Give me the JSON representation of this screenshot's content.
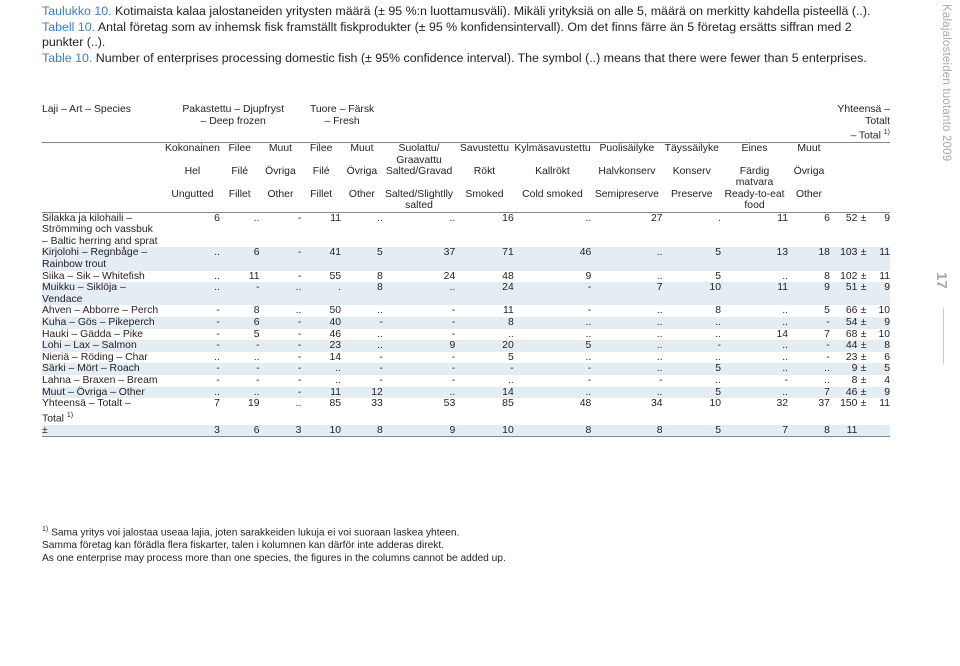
{
  "sidebar": {
    "title": "Kalajalosteiden tuotanto 2009",
    "page_number": "17"
  },
  "captions": [
    {
      "label": "Taulukko 10.",
      "text": "Kotimaista kalaa jalostaneiden yritysten määrä (± 95 %:n luottamusväli). Mikäli yrityksiä on alle 5, määrä on merkitty kahdella pisteellä (..)."
    },
    {
      "label": "Tabell 10.",
      "text": "Antal företag som av inhemsk fisk framställt fiskprodukter (± 95 % konfidensintervall). Om det finns färre än 5 företag ersätts siffran med 2 punkter (..)."
    },
    {
      "label": "Table 10.",
      "text": "Number of enterprises processing domestic fish  (± 95% confidence interval). The symbol (..) means that there were fewer than 5 enterprises."
    }
  ],
  "table": {
    "species_header": "Laji – Art – Species",
    "groups": [
      "Pakastettu – Djupfryst\n– Deep frozen",
      "Tuore – Färsk\n– Fresh"
    ],
    "total_header": "Yhteensä – Totalt\n– Total ",
    "total_header_sup": "1)",
    "columns": [
      {
        "fi": "Kokonainen",
        "sv": "Hel",
        "en": "Ungutted"
      },
      {
        "fi": "Filee",
        "sv": "Filé",
        "en": "Fillet"
      },
      {
        "fi": "Muut",
        "sv": "Övriga",
        "en": "Other"
      },
      {
        "fi": "Filee",
        "sv": "Filé",
        "en": "Fillet"
      },
      {
        "fi": "Muut",
        "sv": "Övriga",
        "en": "Other"
      },
      {
        "fi": "Suolattu/\nGraavattu",
        "sv": "Salted/Gravad",
        "en": "Salted/Slightlly\nsalted"
      },
      {
        "fi": "Savustettu",
        "sv": "Rökt",
        "en": "Smoked"
      },
      {
        "fi": "Kylmäsavustettu",
        "sv": "Kallrökt",
        "en": "Cold smoked"
      },
      {
        "fi": "Puolisäilyke",
        "sv": "Halvkonserv",
        "en": "Semipreserve"
      },
      {
        "fi": "Täyssäilyke",
        "sv": "Konserv",
        "en": "Preserve"
      },
      {
        "fi": "Eines",
        "sv": "Färdig matvara",
        "en": "Ready-to-eat\nfood"
      },
      {
        "fi": "Muut",
        "sv": "Övriga",
        "en": "Other"
      }
    ],
    "rows": [
      {
        "species": "Silakka ja kilohaili –\nStrömming och vassbuk\n– Baltic herring and sprat",
        "values": [
          "6",
          "..",
          "-",
          "11",
          "..",
          "..",
          "16",
          "..",
          "27",
          ".",
          "11",
          "6"
        ],
        "total": "52",
        "pm": "±",
        "ci": "9"
      },
      {
        "species": "Kirjolohi – Regnbåge –\nRainbow trout",
        "values": [
          "..",
          "6",
          "-",
          "41",
          "5",
          "37",
          "71",
          "46",
          "..",
          "5",
          "13",
          "18"
        ],
        "total": "103",
        "pm": "±",
        "ci": "11"
      },
      {
        "species": "Siika – Sik – Whitefish",
        "values": [
          "..",
          "11",
          "-",
          "55",
          "8",
          "24",
          "48",
          "9",
          "..",
          "5",
          "..",
          "8"
        ],
        "total": "102",
        "pm": "±",
        "ci": "11"
      },
      {
        "species": "Muikku – Siklöja –\nVendace",
        "values": [
          "..",
          "-",
          "..",
          ".",
          "8",
          "..",
          "24",
          "-",
          "7",
          "10",
          "11",
          "9"
        ],
        "total": "51",
        "pm": "±",
        "ci": "9"
      },
      {
        "species": "Ahven – Abborre – Perch",
        "values": [
          "-",
          "8",
          "..",
          "50",
          "..",
          "-",
          "11",
          "-",
          "..",
          "8",
          "..",
          "5"
        ],
        "total": "66",
        "pm": "±",
        "ci": "10"
      },
      {
        "species": "Kuha – Gös – Pikeperch",
        "values": [
          "-",
          "6",
          "-",
          "40",
          "-",
          "-",
          "8",
          "..",
          "..",
          "..",
          "..",
          "-"
        ],
        "total": "54",
        "pm": "±",
        "ci": "9"
      },
      {
        "species": "Hauki – Gädda – Pike",
        "values": [
          "-",
          "5",
          "-",
          "46",
          "..",
          "-",
          "..",
          "..",
          "..",
          "..",
          "14",
          "7"
        ],
        "total": "68",
        "pm": "±",
        "ci": "10"
      },
      {
        "species": "Lohi – Lax – Salmon",
        "values": [
          "-",
          "-",
          "-",
          "23",
          "..",
          "9",
          "20",
          "5",
          "..",
          "-",
          "..",
          "-"
        ],
        "total": "44",
        "pm": "±",
        "ci": "8"
      },
      {
        "species": "Nieriä – Röding – Char",
        "values": [
          "..",
          "..",
          "-",
          "14",
          "-",
          "-",
          "5",
          "..",
          "..",
          "..",
          "..",
          "-"
        ],
        "total": "23",
        "pm": "±",
        "ci": "6"
      },
      {
        "species": "Särki – Mört – Roach",
        "values": [
          "-",
          "-",
          "-",
          "..",
          "-",
          "-",
          "-",
          "-",
          "..",
          "5",
          "..",
          ".."
        ],
        "total": "9",
        "pm": "±",
        "ci": "5"
      },
      {
        "species": "Lahna – Braxen – Bream",
        "values": [
          "-",
          "-",
          "-",
          "..",
          "-",
          "-",
          "..",
          "-",
          "-",
          "..",
          "-",
          ".."
        ],
        "total": "8",
        "pm": "±",
        "ci": "4"
      },
      {
        "species": "Muut – Övriga – Other",
        "values": [
          "..",
          "..",
          "-",
          "11",
          "12",
          "..",
          "14",
          "..",
          "..",
          "5",
          "..",
          "7"
        ],
        "total": "46",
        "pm": "±",
        "ci": "9"
      }
    ],
    "total_row": {
      "species": "Yhteensä – Totalt –\nTotal ",
      "species_sup": "1)",
      "values": [
        "7",
        "19",
        "..",
        "85",
        "33",
        "53",
        "85",
        "48",
        "34",
        "10",
        "32",
        "37"
      ],
      "total": "150",
      "pm": "±",
      "ci": "11"
    },
    "ci_row": {
      "label": "±",
      "values": [
        "3",
        "6",
        "3",
        "10",
        "8",
        "9",
        "10",
        "8",
        "8",
        "5",
        "7",
        "8"
      ],
      "total": "11",
      "pm": "",
      "ci": ""
    }
  },
  "footnote": {
    "marker": "1)",
    "lines": [
      "Sama yritys voi jalostaa useaa lajia, joten sarakkeiden lukuja ei voi suoraan laskea yhteen.",
      "Samma företag kan förädla flera fiskarter, talen i kolumnen kan därför inte adderas direkt.",
      "As one enterprise may process more than one species, the figures in the columns cannot be added up."
    ]
  },
  "colors": {
    "caption_label": "#3f7fbf",
    "row_alt": "#e4ecf4",
    "rule": "#7b8a99",
    "sidebar_text": "#a7a9ac"
  }
}
